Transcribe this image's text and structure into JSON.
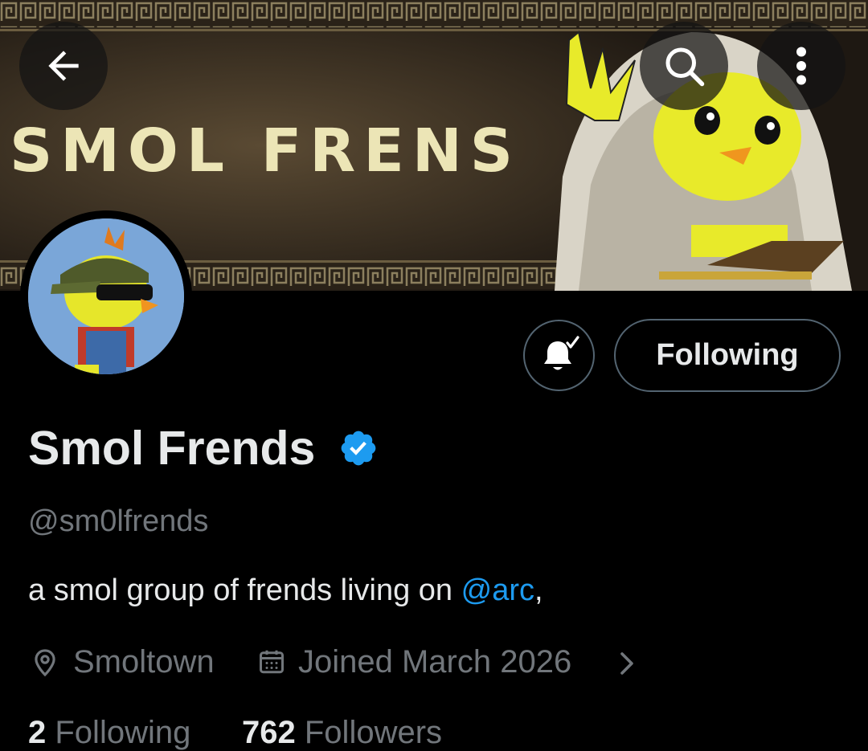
{
  "banner": {
    "title": "SMOL FRENS"
  },
  "header": {
    "back_icon": "arrow-left-icon",
    "search_icon": "search-icon",
    "more_icon": "more-vertical-icon"
  },
  "profile": {
    "display_name": "Smol Frends",
    "verified": true,
    "verified_color": "#1d9bf0",
    "handle": "@sm0lfrends",
    "bio_prefix": "a smol group of frends living on ",
    "bio_mention": "@arc",
    "bio_suffix": ",",
    "location": "Smoltown",
    "joined": "Joined March 2026"
  },
  "actions": {
    "notify_icon": "bell-check-icon",
    "follow_label": "Following"
  },
  "stats": {
    "following_count": "2",
    "following_label": "Following",
    "followers_count": "762",
    "followers_label": "Followers"
  },
  "colors": {
    "accent": "#1d9bf0",
    "muted": "#71767b",
    "background": "#000000"
  }
}
